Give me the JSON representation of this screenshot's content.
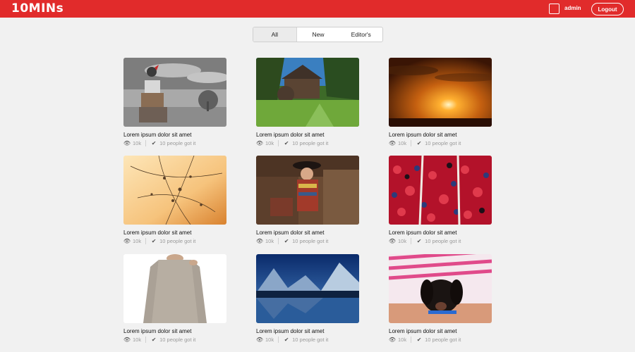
{
  "app": {
    "logo": "10MINs"
  },
  "header": {
    "user_name": "admin",
    "logout_label": "Logout"
  },
  "tabs": [
    {
      "label": "All",
      "active": true
    },
    {
      "label": "New",
      "active": false
    },
    {
      "label": "Editor's",
      "active": false
    }
  ],
  "cards": [
    {
      "title": "Lorem ipsum dolor sit amet",
      "views": "10k",
      "got_it": "10 people got it"
    },
    {
      "title": "Lorem ipsum dolor sit amet",
      "views": "10k",
      "got_it": "10 people got it"
    },
    {
      "title": "Lorem ipsum dolor sit amet",
      "views": "10k",
      "got_it": "10 people got it"
    },
    {
      "title": "Lorem ipsum dolor sit amet",
      "views": "10k",
      "got_it": "10 people got it"
    },
    {
      "title": "Lorem ipsum dolor sit amet",
      "views": "10k",
      "got_it": "10 people got it"
    },
    {
      "title": "Lorem ipsum dolor sit amet",
      "views": "10k",
      "got_it": "10 people got it"
    },
    {
      "title": "Lorem ipsum dolor sit amet",
      "views": "10k",
      "got_it": "10 people got it"
    },
    {
      "title": "Lorem ipsum dolor sit amet",
      "views": "10k",
      "got_it": "10 people got it"
    },
    {
      "title": "Lorem ipsum dolor sit amet",
      "views": "10k",
      "got_it": "10 people got it"
    }
  ],
  "icons": {
    "views": "eye-icon",
    "got_it": "checkmark-icon"
  },
  "colors": {
    "brand": "#e12b2b",
    "background": "#f1f1f1",
    "meta_text": "#9a9a9a"
  }
}
